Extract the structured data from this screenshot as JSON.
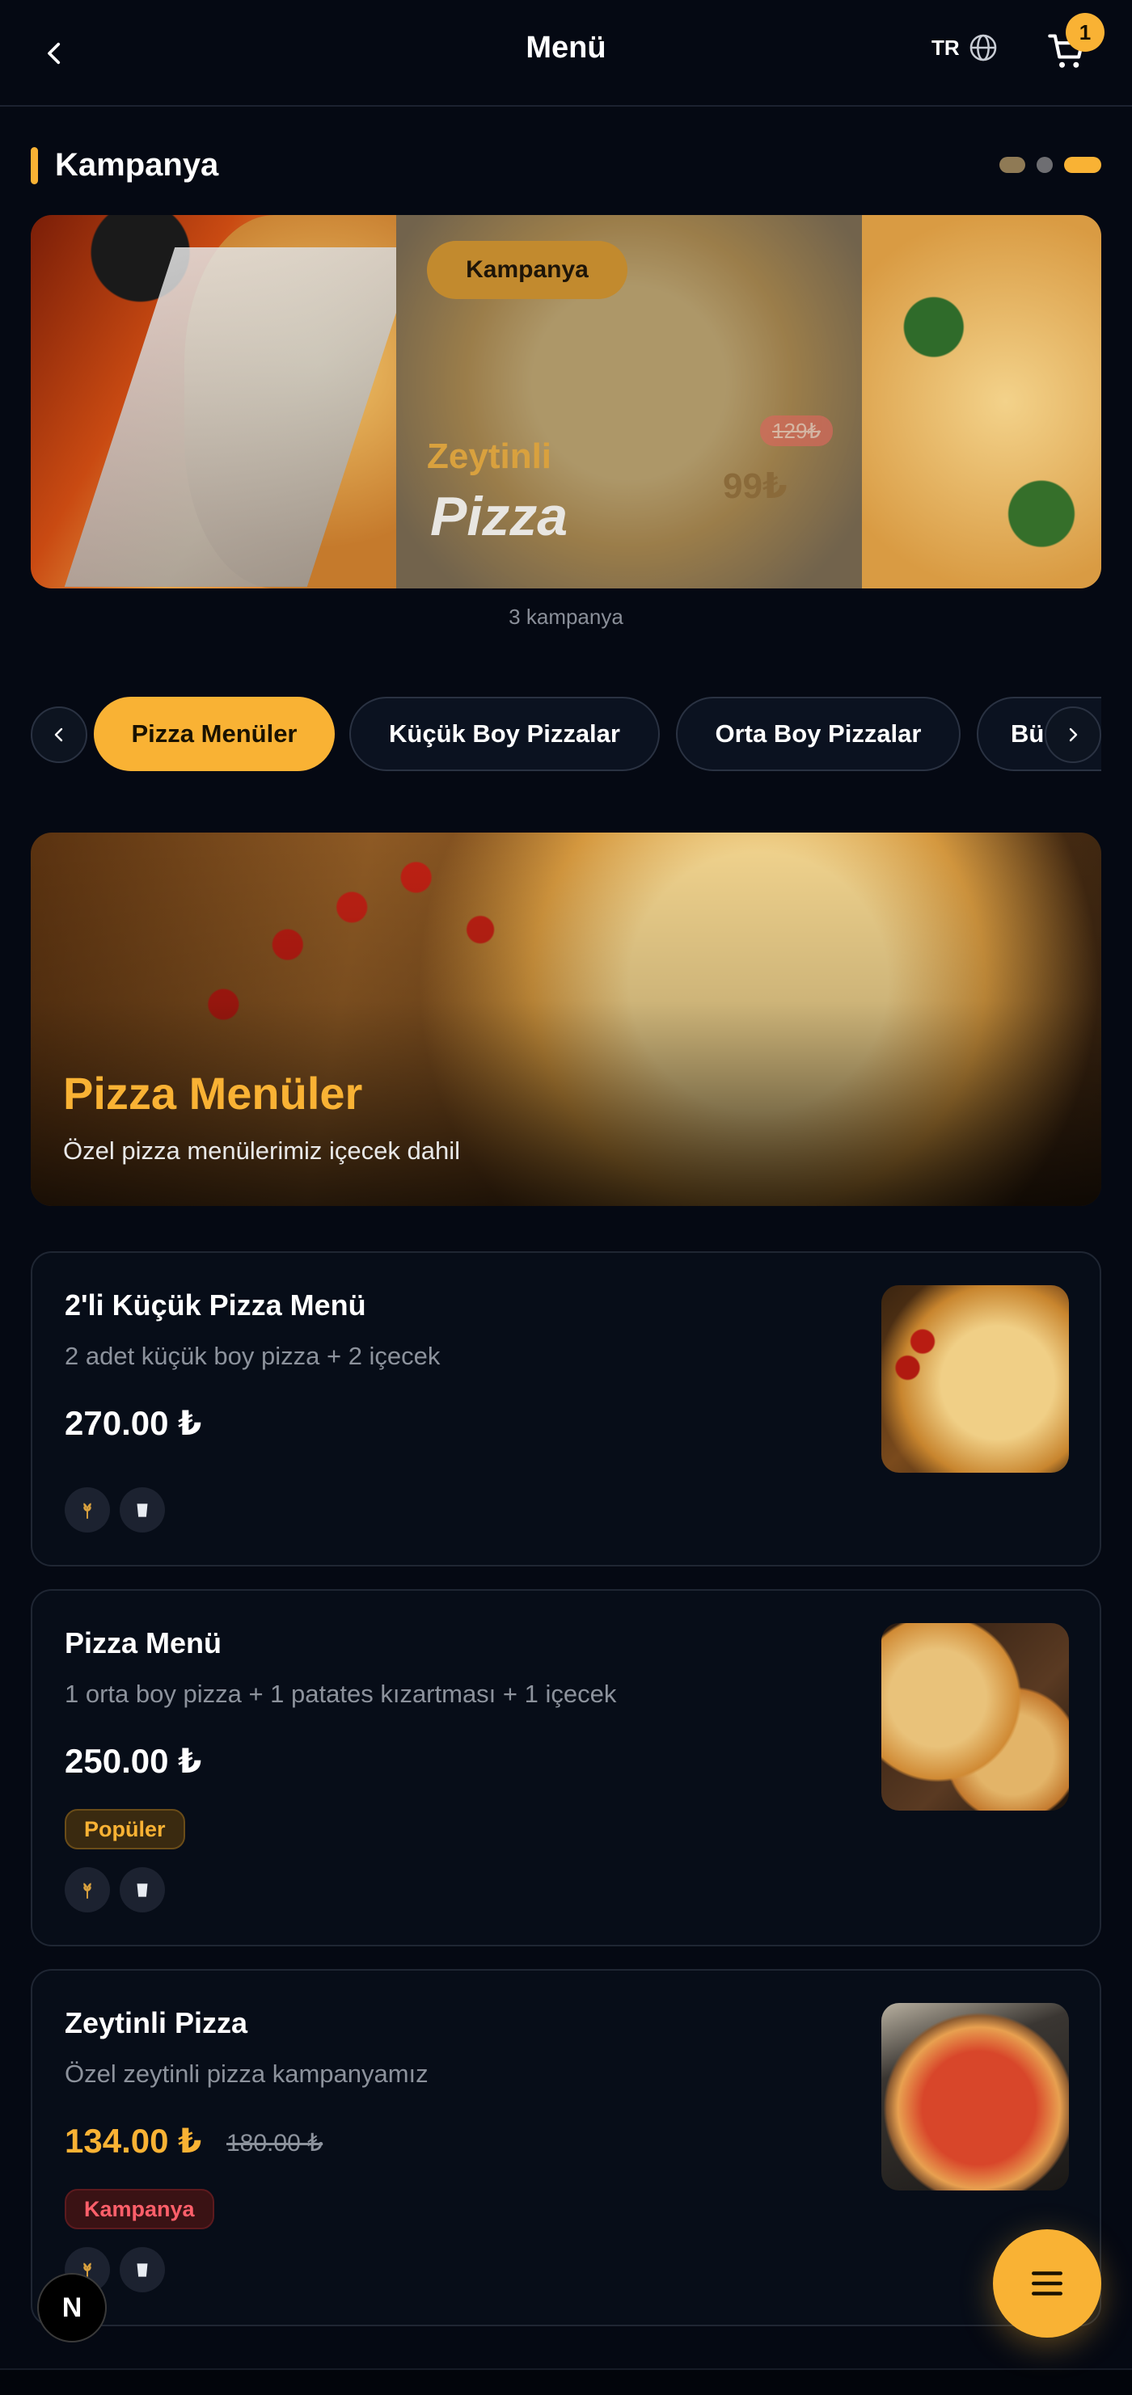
{
  "header": {
    "title": "Menü",
    "lang": "TR",
    "cart_count": "1"
  },
  "campaign_section": {
    "title": "Kampanya",
    "slide": {
      "pill": "Kampanya",
      "title_line1": "Zeytinli",
      "title_line2": "Pizza",
      "old_price": "129₺",
      "new_price": "99₺"
    },
    "count_text": "3 kampanya"
  },
  "categories": [
    {
      "label": "Pizza Menüler",
      "active": true
    },
    {
      "label": "Küçük Boy Pizzalar",
      "active": false
    },
    {
      "label": "Orta Boy Pizzalar",
      "active": false
    },
    {
      "label": "Bü",
      "active": false
    }
  ],
  "hero": {
    "title": "Pizza Menüler",
    "subtitle": "Özel pizza menülerimiz içecek dahil"
  },
  "products": [
    {
      "name": "2'li Küçük Pizza Menü",
      "description": "2 adet küçük boy pizza + 2 içecek",
      "price": "270.00 ₺",
      "allergens": [
        "wheat-icon",
        "cup-icon"
      ]
    },
    {
      "name": "Pizza Menü",
      "description": "1 orta boy pizza + 1 patates kızartması + 1 içecek",
      "price": "250.00 ₺",
      "badge": "Popüler",
      "allergens": [
        "wheat-icon",
        "cup-icon"
      ]
    },
    {
      "name": "Zeytinli Pizza",
      "description": "Özel zeytinli pizza kampanyamız",
      "price": "134.00 ₺",
      "old_price": "180.00 ₺",
      "badge": "Kampanya",
      "allergens": [
        "wheat-icon",
        "cup-icon"
      ]
    }
  ],
  "fab": {
    "icon": "menu-icon"
  },
  "dev_badge": {
    "letter": "N"
  },
  "colors": {
    "background": "#050913",
    "accent": "#f9b234",
    "card": "#070d18",
    "campaign_badge": "#ff5f6a"
  }
}
